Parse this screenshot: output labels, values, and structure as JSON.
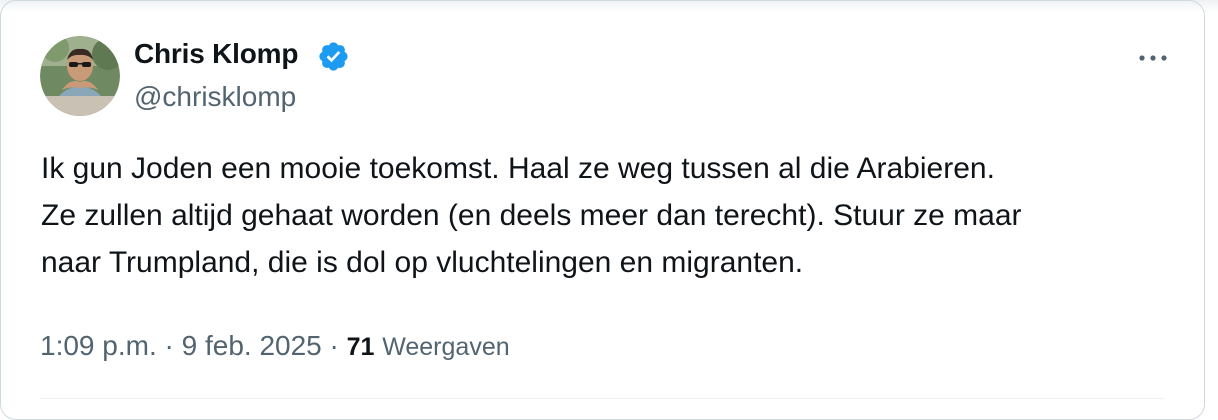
{
  "tweet": {
    "author_name": "Chris Klomp",
    "author_handle": "@chrisklomp",
    "verified": true,
    "text_lines": [
      "Ik gun Joden een mooie toekomst. Haal ze weg tussen al die Arabieren.",
      "Ze zullen altijd gehaat worden (en deels meer dan terecht). Stuur ze maar",
      "naar Trumpland, die is dol op vluchtelingen en migranten."
    ],
    "time": "1:09 p.m.",
    "separator": " · ",
    "date": "9 feb. 2025",
    "views_count": "71",
    "views_label": "Weergaven"
  },
  "icons": {
    "verified": "verified-badge-icon",
    "more": "more-horizontal-icon",
    "avatar": "profile-photo"
  },
  "colors": {
    "verified_blue": "#1d9bf0",
    "text_primary": "#0f1419",
    "text_secondary": "#536471",
    "border": "#cfd9de"
  }
}
